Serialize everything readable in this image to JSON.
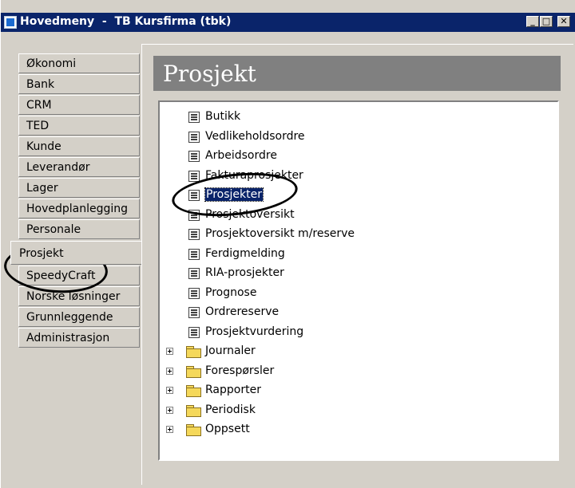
{
  "window": {
    "title": "Hovedmeny  -  TB Kursfirma (tbk)",
    "controls": {
      "minimize": "_",
      "maximize": "□",
      "close": "✕"
    }
  },
  "sidebar": {
    "items": [
      {
        "label": "Økonomi",
        "active": false
      },
      {
        "label": "Bank",
        "active": false
      },
      {
        "label": "CRM",
        "active": false
      },
      {
        "label": "TED",
        "active": false
      },
      {
        "label": "Kunde",
        "active": false
      },
      {
        "label": "Leverandør",
        "active": false
      },
      {
        "label": "Lager",
        "active": false
      },
      {
        "label": "Hovedplanlegging",
        "active": false
      },
      {
        "label": "Personale",
        "active": false
      },
      {
        "label": "Prosjekt",
        "active": true
      },
      {
        "label": "SpeedyCraft",
        "active": false
      },
      {
        "label": "Norske løsninger",
        "active": false
      },
      {
        "label": "Grunnleggende",
        "active": false
      },
      {
        "label": "Administrasjon",
        "active": false
      }
    ]
  },
  "main": {
    "header": "Prosjekt",
    "tree": {
      "documents": [
        "Butikk",
        "Vedlikeholdsordre",
        "Arbeidsordre",
        "Fakturaprosjekter",
        "Prosjekter",
        "Prosjektoversikt",
        "Prosjektoversikt m/reserve",
        "Ferdigmelding",
        "RIA-prosjekter",
        "Prognose",
        "Ordrereserve",
        "Prosjektvurdering"
      ],
      "selected": "Prosjekter",
      "folders": [
        "Journaler",
        "Forespørsler",
        "Rapporter",
        "Periodisk",
        "Oppsett"
      ]
    }
  },
  "colors": {
    "titlebar": "#0a246a",
    "header_bg": "#808080",
    "selection": "#0a246a",
    "chrome": "#d4d0c8"
  }
}
